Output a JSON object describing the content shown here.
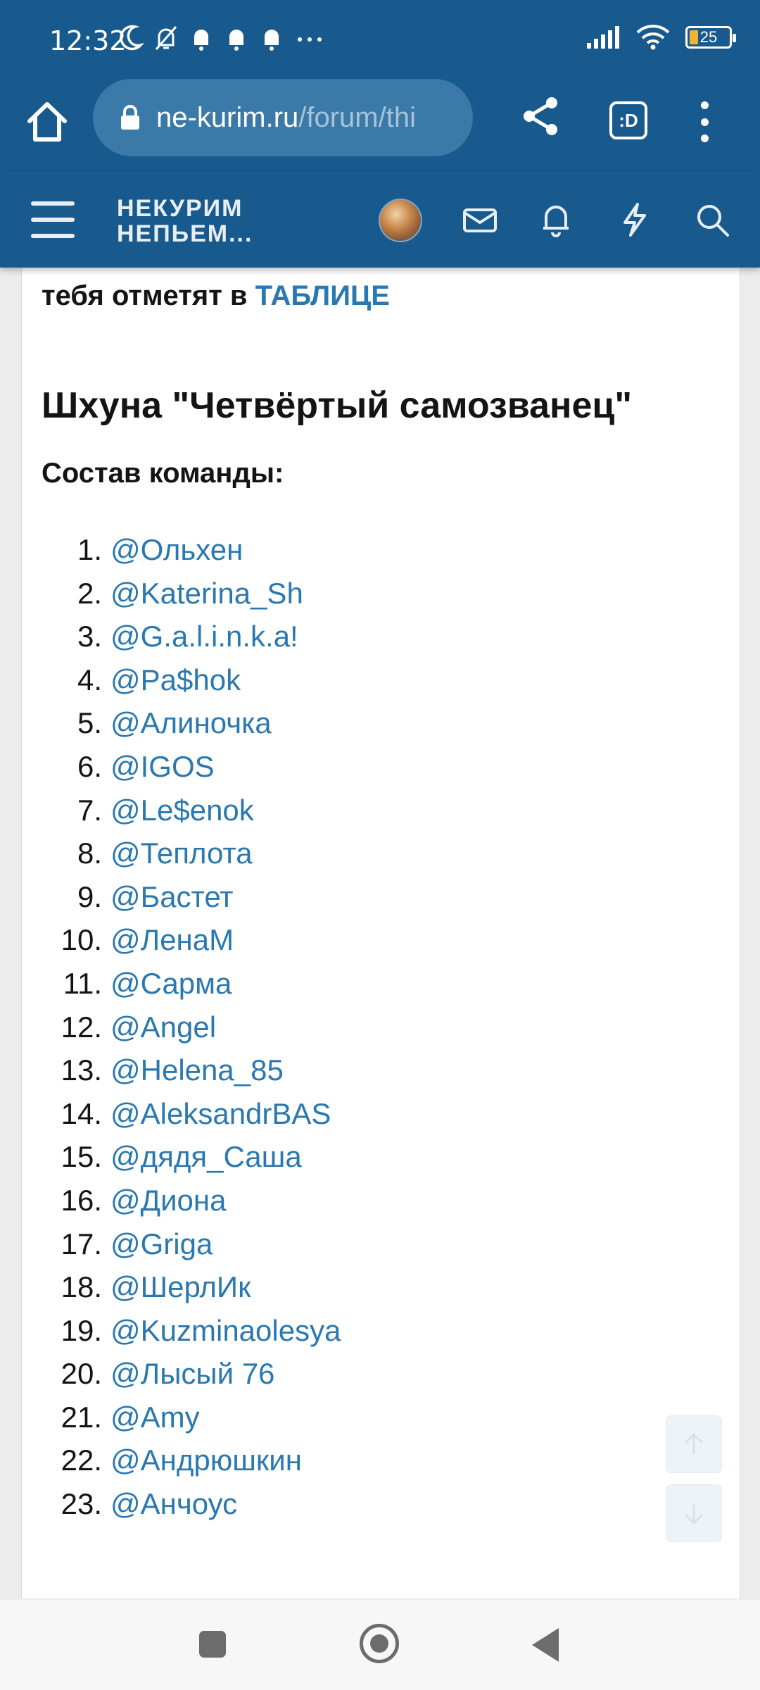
{
  "status_bar": {
    "time": "12:32",
    "battery": "25",
    "icons": [
      "moon-icon",
      "bell-off-icon",
      "bell-icon",
      "bell-icon",
      "bell-icon",
      "more-icon",
      "signal-icon",
      "wifi-icon",
      "battery-icon"
    ]
  },
  "browser": {
    "url_host": "ne-kurim.ru",
    "url_path": "/forum/thi",
    "tab_label": ":D"
  },
  "site_header": {
    "logo_line1": "НЕКУРИМ",
    "logo_line2": "НЕПЬЕМ..."
  },
  "post": {
    "intro_text": "тебя отметят в ",
    "intro_link": "ТАБЛИЦЕ",
    "ship_title": "Шхуна \"Четвёртый самозванец\"",
    "team_label": "Состав команды:",
    "members": [
      {
        "num": "1.",
        "nick": "@Ольхен"
      },
      {
        "num": "2.",
        "nick": "@Katerina_Sh"
      },
      {
        "num": "3.",
        "nick": "@G.a.l.i.n.k.a!"
      },
      {
        "num": "4.",
        "nick": "@Pa$hok"
      },
      {
        "num": "5.",
        "nick": "@Алиночка"
      },
      {
        "num": "6.",
        "nick": "@IGOS"
      },
      {
        "num": "7.",
        "nick": "@Le$enok"
      },
      {
        "num": "8.",
        "nick": "@Теплота"
      },
      {
        "num": "9.",
        "nick": "@Бастет"
      },
      {
        "num": "10.",
        "nick": "@ЛенаМ"
      },
      {
        "num": "11.",
        "nick": "@Сарма"
      },
      {
        "num": "12.",
        "nick": "@Angel"
      },
      {
        "num": "13.",
        "nick": "@Helena_85"
      },
      {
        "num": "14.",
        "nick": "@AleksandrBAS"
      },
      {
        "num": "15.",
        "nick": "@дядя_Саша"
      },
      {
        "num": "16.",
        "nick": "@Диона"
      },
      {
        "num": "17.",
        "nick": "@Griga"
      },
      {
        "num": "18.",
        "nick": "@ШерлИк"
      },
      {
        "num": "19.",
        "nick": "@Kuzminaolesya"
      },
      {
        "num": "20.",
        "nick": "@Лысый 76"
      },
      {
        "num": "21.",
        "nick": "@Amy"
      },
      {
        "num": "22.",
        "nick": "@Андрюшкин"
      },
      {
        "num": "23.",
        "nick": "@Анчоус"
      }
    ]
  },
  "colors": {
    "header": "#185a8d",
    "link": "#2a78b0",
    "text": "#141414"
  }
}
